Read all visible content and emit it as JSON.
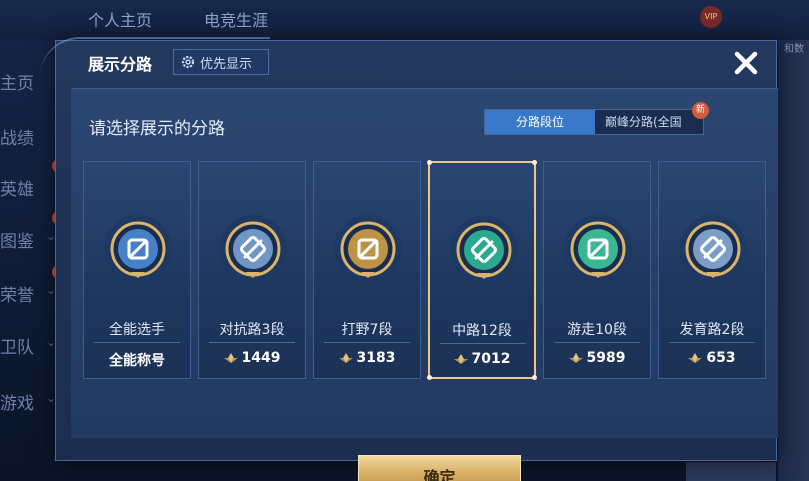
{
  "background": {
    "tabs": [
      "个人主页",
      "电竞生涯"
    ],
    "vip_badge": "VIP",
    "sidebar": [
      {
        "label": "主页",
        "chevron": false,
        "new": ""
      },
      {
        "label": "战绩",
        "chevron": false,
        "new": ""
      },
      {
        "label": "英雄",
        "chevron": false,
        "new": "新"
      },
      {
        "label": "图鉴",
        "chevron": true,
        "new": "新"
      },
      {
        "label": "荣誉",
        "chevron": true,
        "new": "新"
      },
      {
        "label": "卫队",
        "chevron": true,
        "new": ""
      },
      {
        "label": "游戏",
        "chevron": true,
        "new": ""
      }
    ],
    "right_text": "和数"
  },
  "modal": {
    "title": "展示分路",
    "priority_label": "优先显示",
    "prompt": "请选择展示的分路",
    "tabs": [
      {
        "label": "分路段位",
        "active": true
      },
      {
        "label": "巅峰分路(全国",
        "active": false,
        "badge": "新"
      }
    ],
    "cards": [
      {
        "name": "全能选手",
        "value": "全能称号",
        "show_icon": false,
        "selected": false,
        "emblem": "all-round-emblem",
        "accent": "#4f8fdc"
      },
      {
        "name": "对抗路3段",
        "value": "1449",
        "show_icon": true,
        "selected": false,
        "emblem": "clash-lane-emblem",
        "accent": "#7fa9d8"
      },
      {
        "name": "打野7段",
        "value": "3183",
        "show_icon": true,
        "selected": false,
        "emblem": "jungle-emblem",
        "accent": "#d9a645"
      },
      {
        "name": "中路12段",
        "value": "7012",
        "show_icon": true,
        "selected": true,
        "emblem": "mid-lane-emblem",
        "accent": "#2fbf9a"
      },
      {
        "name": "游走10段",
        "value": "5989",
        "show_icon": true,
        "selected": false,
        "emblem": "roam-emblem",
        "accent": "#3fcf9e"
      },
      {
        "name": "发育路2段",
        "value": "653",
        "show_icon": true,
        "selected": false,
        "emblem": "farm-lane-emblem",
        "accent": "#8fb2dc"
      }
    ],
    "confirm_label": "确定"
  }
}
